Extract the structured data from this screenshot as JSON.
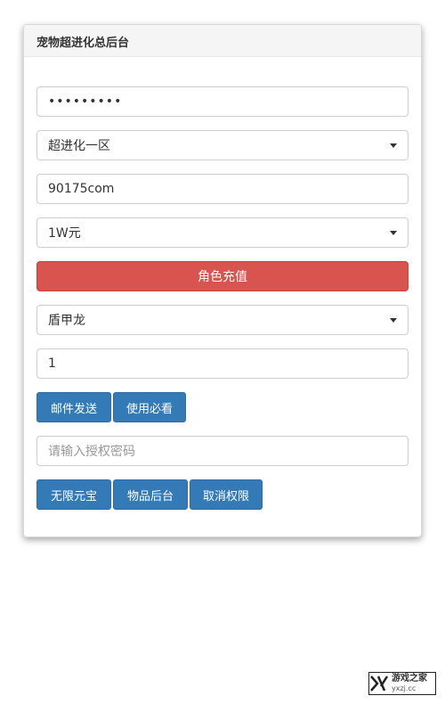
{
  "header": {
    "title": "宠物超进化总后台"
  },
  "password_field": {
    "value": "•••••••••"
  },
  "server_select": {
    "value": "超进化一区"
  },
  "account_field": {
    "value": "90175com"
  },
  "amount_select": {
    "value": "1W元"
  },
  "recharge_button": {
    "label": "角色充值"
  },
  "pet_select": {
    "value": "盾甲龙"
  },
  "quantity_field": {
    "value": "1"
  },
  "action_buttons": {
    "mail_send": "邮件发送",
    "must_read": "使用必看"
  },
  "auth_field": {
    "placeholder": "请输入授权密码"
  },
  "admin_buttons": {
    "unlimited_ingots": "无限元宝",
    "items_backend": "物品后台",
    "revoke_permission": "取消权限"
  },
  "watermark": {
    "name": "游戏之家",
    "site": "yxzj.cc"
  },
  "colors": {
    "danger": "#d9534f",
    "primary": "#337ab7"
  }
}
